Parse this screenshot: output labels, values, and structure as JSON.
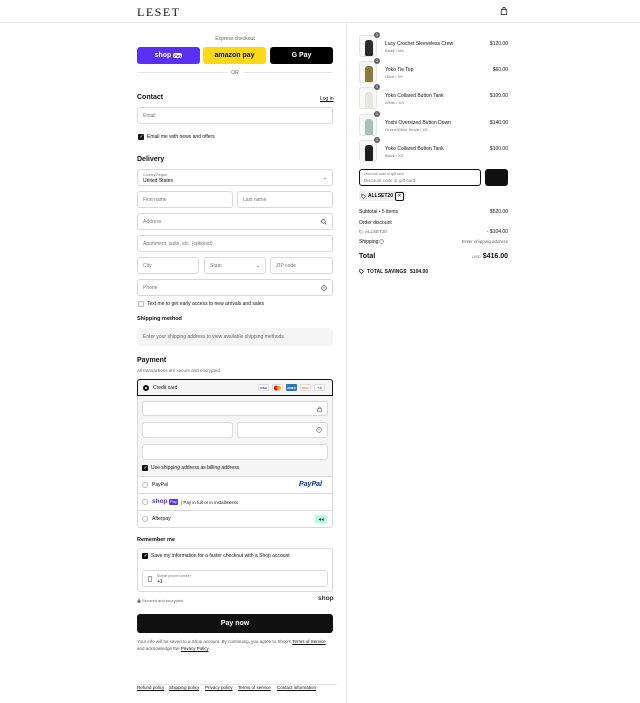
{
  "brand": {
    "logo": "LESET"
  },
  "express": {
    "label": "Express checkout",
    "shoppay": "shop",
    "shoppay_badge": "Pay",
    "amazonpay": "amazon pay",
    "gpay": "G Pay",
    "or": "OR"
  },
  "contact": {
    "title": "Contact",
    "login": "Log in",
    "email_placeholder": "Email",
    "newsletter_label": "Email me with news and offers"
  },
  "delivery": {
    "title": "Delivery",
    "country_label": "Country/Region",
    "country_value": "United States",
    "first_name": "First name",
    "last_name": "Last name",
    "address": "Address",
    "apartment": "Apartment, suite, etc. (optional)",
    "city": "City",
    "state": "State",
    "zip": "ZIP code",
    "phone": "Phone",
    "sms_label": "Text me to get early access to new arrivals and sales"
  },
  "shipping_method": {
    "title": "Shipping method",
    "info": "Enter your shipping address to view available shipping methods."
  },
  "payment": {
    "title": "Payment",
    "subtitle": "All transactions are secure and encrypted.",
    "credit_card": "Credit card",
    "card_logos": [
      "VISA",
      "MC",
      "AMEX",
      "DISC"
    ],
    "more_cards": "+4",
    "billing_same": "Use shipping address as billing address",
    "paypal": "PayPal",
    "paypal_logo": "PayPal",
    "shoppay_logo": "shop",
    "shoppay_badge": "Pay",
    "shoppay_text": "| Pay in full or in installments",
    "afterpay": "Afterpay"
  },
  "remember": {
    "title": "Remember me",
    "save_label": "Save my information for a faster checkout with a Shop account",
    "mobile_label": "Mobile phone number",
    "mobile_prefix": "+1",
    "secure": "Secured and encrypted",
    "shop_logo": "shop"
  },
  "paynow": "Pay now",
  "legal": {
    "text1": "Your info will be saved to a Shop account. By continuing, you agree to Shop's ",
    "tos": "Terms of Service",
    "text2": "and acknowledge the ",
    "privacy": "Privacy Policy",
    "dot": "."
  },
  "footer": {
    "links": [
      "Refund policy",
      "Shipping policy",
      "Privacy policy",
      "Terms of service",
      "Contact information"
    ]
  },
  "cart": {
    "items": [
      {
        "name": "Lucy Crochet Sleeveless Crew",
        "variant": "Black / M/L",
        "price": "$120.00",
        "qty": "1",
        "color": "#2b2b2b"
      },
      {
        "name": "Yoko Tie Top",
        "variant": "Olive / XS",
        "price": "$60.00",
        "qty": "1",
        "color": "#8a7a3c"
      },
      {
        "name": "Yoko Collared Button Tank",
        "variant": "White / XS",
        "price": "$100.00",
        "qty": "1",
        "color": "#e8e6e0"
      },
      {
        "name": "Yoshi Oversized Button Down",
        "variant": "Green/White Stripe / XS",
        "price": "$140.00",
        "qty": "1",
        "color": "#a9c1b8"
      },
      {
        "name": "Yoko Collared Button Tank",
        "variant": "Black / XS",
        "price": "$100.00",
        "qty": "1",
        "color": "#1e1e1e"
      }
    ],
    "discount_label": "Discount code or gift card",
    "discount_placeholder": "Discount code or gift card",
    "applied_code": "ALLSET20"
  },
  "summary": {
    "subtotal_label": "Subtotal • 5 items",
    "subtotal_value": "$520.00",
    "order_discount_label": "Order discount",
    "discount_code": "ALLSET20",
    "discount_value": "- $104.00",
    "shipping_label": "Shipping",
    "shipping_value": "Enter shipping address",
    "total_label": "Total",
    "currency": "USD",
    "total_value": "$416.00",
    "savings_label": "TOTAL SAVINGS",
    "savings_value": "$104.00"
  }
}
